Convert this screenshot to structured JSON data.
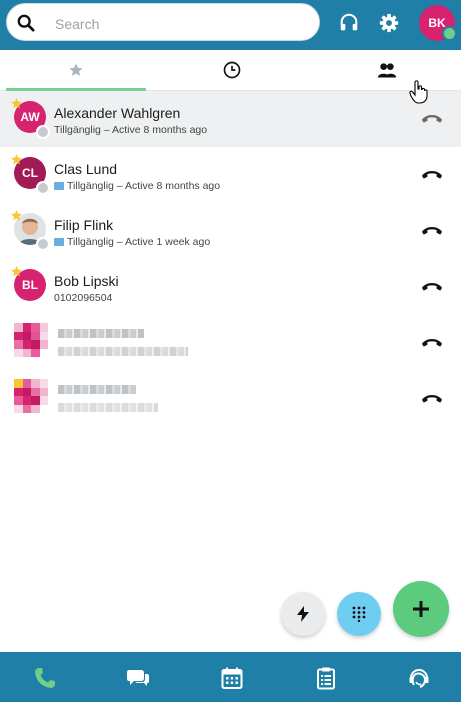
{
  "search": {
    "placeholder": "Search"
  },
  "user": {
    "initials": "BK",
    "status_color": "#6ecf8a"
  },
  "tabs": [
    {
      "icon": "star-icon",
      "active": true
    },
    {
      "icon": "clock-icon",
      "active": false
    },
    {
      "icon": "contacts-icon",
      "active": false
    }
  ],
  "contacts": [
    {
      "initials": "AW",
      "name": "Alexander Wahlgren",
      "status": "Tillgänglig – Active 8 months ago",
      "favorite": true,
      "avatar_color": "#d6226f",
      "highlighted": true
    },
    {
      "initials": "CL",
      "name": "Clas Lund",
      "status": "Tillgänglig – Active 8 months ago",
      "favorite": true,
      "avatar_color": "#a21a55"
    },
    {
      "initials": "",
      "name": "Filip Flink",
      "status": "Tillgänglig – Active 1 week ago",
      "favorite": true,
      "avatar_color": "#e7d9cf"
    },
    {
      "initials": "BL",
      "name": "Bob Lipski",
      "status": "0102096504",
      "favorite": true,
      "avatar_color": "#d6226f"
    }
  ],
  "colors": {
    "brand": "#1f7fa6",
    "accent_green": "#6ecf8a",
    "fab_blue": "#6fcdf2",
    "fab_green": "#5ccb7d",
    "avatar_pink": "#d6226f"
  }
}
